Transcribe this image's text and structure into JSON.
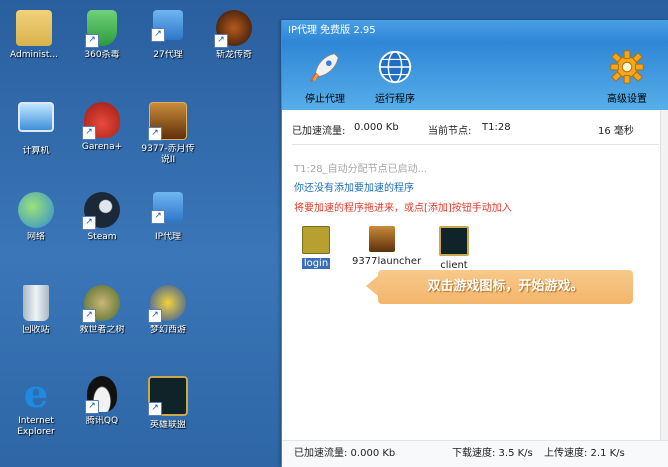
{
  "desktop": {
    "icons": [
      {
        "label": "Administ...",
        "icon": "user-folder-icon",
        "color": "#d9b24c"
      },
      {
        "label": "360杀毒",
        "icon": "shield-icon",
        "color": "#3aa64b"
      },
      {
        "label": "27代理",
        "icon": "network-icon",
        "color": "#3b82d6"
      },
      {
        "label": "斩龙传奇",
        "icon": "game-icon",
        "color": "#6b2d0c"
      },
      {
        "label": "计算机",
        "icon": "computer-icon",
        "color": "#8fd2ff"
      },
      {
        "label": "Garena+",
        "icon": "garena-icon",
        "color": "#d02c21"
      },
      {
        "label": "9377-赤月传说II",
        "icon": "game-icon",
        "color": "#7a4a12"
      },
      {
        "label": "网络",
        "icon": "globe-icon",
        "color": "#3f9d46"
      },
      {
        "label": "Steam",
        "icon": "steam-icon",
        "color": "#1b2838"
      },
      {
        "label": "IP代理",
        "icon": "network-icon",
        "color": "#3b82d6"
      },
      {
        "label": "回收站",
        "icon": "recycle-bin-icon",
        "color": "#cfd8e0"
      },
      {
        "label": "救世者之树",
        "icon": "game-icon",
        "color": "#4d6b2b"
      },
      {
        "label": "梦幻西游",
        "icon": "game-icon",
        "color": "#2b53a3"
      },
      {
        "label": "Internet Explorer",
        "icon": "ie-icon",
        "color": "#1e8be3"
      },
      {
        "label": "腾讯QQ",
        "icon": "qq-icon",
        "color": "#111111"
      },
      {
        "label": "英雄联盟",
        "icon": "lol-icon",
        "color": "#1c3a44"
      }
    ]
  },
  "window": {
    "title": "IP代理 免费版 2.95",
    "toolbar": {
      "stop_label": "停止代理",
      "run_label": "运行程序",
      "settings_label": "高级设置"
    },
    "stats": {
      "accelerated_label": "已加速流量:",
      "accelerated_value": "0.000 Kb",
      "node_label": "当前节点:",
      "node_value": "T1:28",
      "latency": "16 毫秒"
    },
    "log_line": "T1:28_自动分配节点已启动...",
    "no_program_msg": "你还没有添加要加速的程序",
    "drag_hint": "将要加速的程序拖进来，或点[添加]按钮手动加入",
    "programs": [
      {
        "label": "login",
        "color": "#b8a030"
      },
      {
        "label": "9377launcher",
        "color": "#7a4a12"
      },
      {
        "label": "client",
        "color": "#1c3a44"
      }
    ],
    "tooltip": "双击游戏图标，开始游戏。",
    "statusbar": {
      "accelerated": "已加速流量: 0.000 Kb",
      "download": "下载速度: 3.5 K/s",
      "upload": "上传速度: 2.1 K/s"
    }
  }
}
